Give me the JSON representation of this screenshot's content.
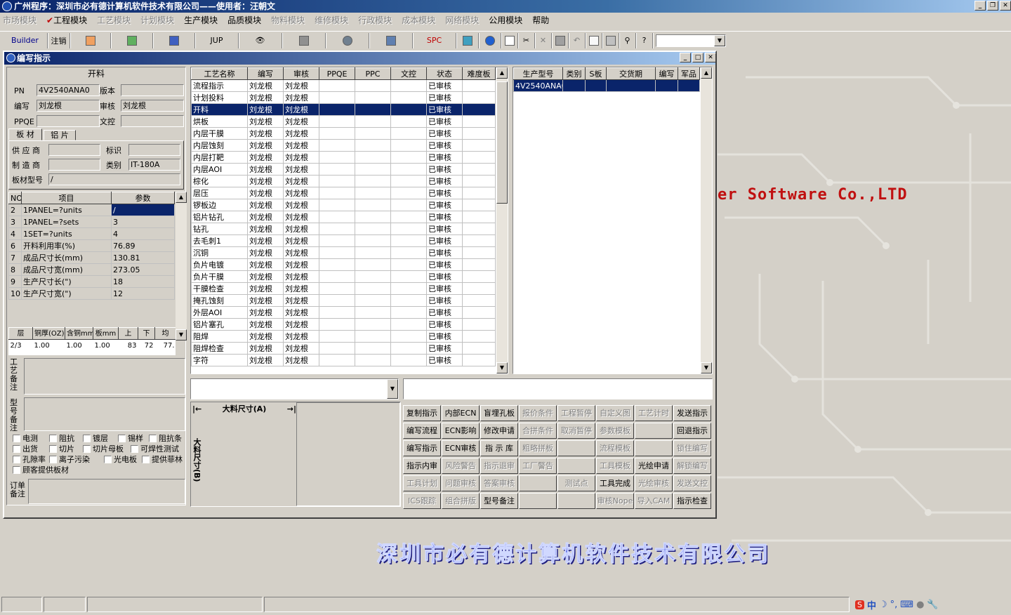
{
  "app_title": "广州程序：深圳市必有德计算机软件技术有限公司——使用者：汪朝文",
  "menu": [
    {
      "label": "市场模块",
      "enabled": false
    },
    {
      "label": "工程模块",
      "enabled": true,
      "checked": true
    },
    {
      "label": "工艺模块",
      "enabled": false
    },
    {
      "label": "计划模块",
      "enabled": false
    },
    {
      "label": "生产模块",
      "enabled": true
    },
    {
      "label": "品质模块",
      "enabled": true
    },
    {
      "label": "物料模块",
      "enabled": false
    },
    {
      "label": "维修模块",
      "enabled": false
    },
    {
      "label": "行政模块",
      "enabled": false
    },
    {
      "label": "成本模块",
      "enabled": false
    },
    {
      "label": "网络模块",
      "enabled": false
    },
    {
      "label": "公用模块",
      "enabled": true
    },
    {
      "label": "帮助",
      "enabled": true
    }
  ],
  "toolbar": {
    "builder": "Builder",
    "logout": "注销",
    "jup": "JUP",
    "spc": "SPC"
  },
  "child_title": "编写指示",
  "left": {
    "process_name": "开料",
    "pn_label": "PN",
    "pn": "4V2540ANA0",
    "version_label": "版本",
    "version": "",
    "writer_label": "编写",
    "writer": "刘龙根",
    "reviewer_label": "审核",
    "reviewer": "刘龙根",
    "ppqe_label": "PPQE",
    "ppqe": "",
    "doc_label": "文控",
    "doc": "",
    "tab_board": "板 材",
    "tab_alu": "铝 片",
    "supplier_label": "供 应 商",
    "supplier": "",
    "mark_label": "标识",
    "mark": "",
    "maker_label": "制 造 商",
    "maker": "",
    "class_label": "类别",
    "class": "IT-180A",
    "model_label": "板材型号",
    "model": "/",
    "param_headers": [
      "NO",
      "项目",
      "参数"
    ],
    "params": [
      [
        "2",
        "1PANEL=?units",
        "/"
      ],
      [
        "3",
        "1PANEL=?sets",
        "3"
      ],
      [
        "4",
        "1SET=?units",
        "4"
      ],
      [
        "6",
        "开料利用率(%)",
        "76.89"
      ],
      [
        "7",
        "成品尺寸长(mm)",
        "130.81"
      ],
      [
        "8",
        "成品尺寸宽(mm)",
        "273.05"
      ],
      [
        "9",
        "生产尺寸长(\")",
        "18"
      ],
      [
        "10",
        "生产尺寸宽(\")",
        "12"
      ]
    ],
    "layer_headers": [
      "层",
      "铜厚(OZ)",
      "含铜mm",
      "板mm",
      "上",
      "下",
      "均"
    ],
    "layer_row": [
      "2/3",
      "1.00",
      "1.00",
      "1.00",
      "83",
      "72",
      "77."
    ],
    "craft_note_label": "工艺备注",
    "model_note_label": "型号备注",
    "order_note_label": "订单备注",
    "checks": [
      [
        "电测",
        "阻抗",
        "镀层",
        "锡样",
        "阻抗条"
      ],
      [
        "出货",
        "切片",
        "切片母板",
        "可焊性测试"
      ],
      [
        "孔隙率",
        "离子污染",
        "光电板",
        "提供菲林"
      ],
      [
        "顾客提供板材"
      ]
    ]
  },
  "process_table": {
    "headers": [
      "工艺名称",
      "编写",
      "审核",
      "PPQE",
      "PPC",
      "文控",
      "状态",
      "难度板"
    ],
    "rows": [
      [
        "流程指示",
        "刘龙根",
        "刘龙根",
        "",
        "",
        "",
        "已审核",
        ""
      ],
      [
        "计划投料",
        "刘龙根",
        "刘龙根",
        "",
        "",
        "",
        "已审核",
        ""
      ],
      [
        "开料",
        "刘龙根",
        "刘龙根",
        "",
        "",
        "",
        "已审核",
        ""
      ],
      [
        "烘板",
        "刘龙根",
        "刘龙根",
        "",
        "",
        "",
        "已审核",
        ""
      ],
      [
        "内层干膜",
        "刘龙根",
        "刘龙根",
        "",
        "",
        "",
        "已审核",
        ""
      ],
      [
        "内层蚀刻",
        "刘龙根",
        "刘龙根",
        "",
        "",
        "",
        "已审核",
        ""
      ],
      [
        "内层打靶",
        "刘龙根",
        "刘龙根",
        "",
        "",
        "",
        "已审核",
        ""
      ],
      [
        "内层AOI",
        "刘龙根",
        "刘龙根",
        "",
        "",
        "",
        "已审核",
        ""
      ],
      [
        "棕化",
        "刘龙根",
        "刘龙根",
        "",
        "",
        "",
        "已审核",
        ""
      ],
      [
        "层压",
        "刘龙根",
        "刘龙根",
        "",
        "",
        "",
        "已审核",
        ""
      ],
      [
        "锣板边",
        "刘龙根",
        "刘龙根",
        "",
        "",
        "",
        "已审核",
        ""
      ],
      [
        "铝片钻孔",
        "刘龙根",
        "刘龙根",
        "",
        "",
        "",
        "已审核",
        ""
      ],
      [
        "钻孔",
        "刘龙根",
        "刘龙根",
        "",
        "",
        "",
        "已审核",
        ""
      ],
      [
        "去毛刺1",
        "刘龙根",
        "刘龙根",
        "",
        "",
        "",
        "已审核",
        ""
      ],
      [
        "沉铜",
        "刘龙根",
        "刘龙根",
        "",
        "",
        "",
        "已审核",
        ""
      ],
      [
        "负片电镀",
        "刘龙根",
        "刘龙根",
        "",
        "",
        "",
        "已审核",
        ""
      ],
      [
        "负片干膜",
        "刘龙根",
        "刘龙根",
        "",
        "",
        "",
        "已审核",
        ""
      ],
      [
        "干膜检查",
        "刘龙根",
        "刘龙根",
        "",
        "",
        "",
        "已审核",
        ""
      ],
      [
        "掩孔蚀刻",
        "刘龙根",
        "刘龙根",
        "",
        "",
        "",
        "已审核",
        ""
      ],
      [
        "外层AOI",
        "刘龙根",
        "刘龙根",
        "",
        "",
        "",
        "已审核",
        ""
      ],
      [
        "铝片塞孔",
        "刘龙根",
        "刘龙根",
        "",
        "",
        "",
        "已审核",
        ""
      ],
      [
        "阻焊",
        "刘龙根",
        "刘龙根",
        "",
        "",
        "",
        "已审核",
        ""
      ],
      [
        "阻焊检查",
        "刘龙根",
        "刘龙根",
        "",
        "",
        "",
        "已审核",
        ""
      ],
      [
        "字符",
        "刘龙根",
        "刘龙根",
        "",
        "",
        "",
        "已审核",
        ""
      ]
    ],
    "selected": 2
  },
  "model_table": {
    "headers": [
      "生产型号",
      "类别",
      "S板",
      "交货期",
      "编写",
      "军品"
    ],
    "rows": [
      [
        "4V2540ANA0",
        "",
        "",
        "",
        "",
        ""
      ]
    ]
  },
  "size_a_label": "大料尺寸(A)",
  "size_b_label": "大料尺寸(B)",
  "actions": [
    [
      [
        "复制指示",
        true
      ],
      [
        "内部ECN",
        true
      ],
      [
        "盲埋孔板",
        true
      ],
      [
        "报价条件",
        false
      ],
      [
        "工程暂停",
        false
      ],
      [
        "自定义图",
        false
      ],
      [
        "工艺计时",
        false
      ],
      [
        "发送指示",
        true
      ]
    ],
    [
      [
        "编写流程",
        true
      ],
      [
        "ECN影响",
        true
      ],
      [
        "修改申请",
        true
      ],
      [
        "合拼条件",
        false
      ],
      [
        "取消暂停",
        false
      ],
      [
        "参数模板",
        false
      ],
      [
        "",
        false
      ],
      [
        "回退指示",
        true
      ]
    ],
    [
      [
        "编写指示",
        true
      ],
      [
        "ECN审核",
        true
      ],
      [
        "指 示 库",
        true
      ],
      [
        "粗略拼板",
        false
      ],
      [
        "",
        false
      ],
      [
        "流程模板",
        false
      ],
      [
        "",
        false
      ],
      [
        "锁住编写",
        false
      ]
    ],
    [
      [
        "指示内审",
        true
      ],
      [
        "风险警告",
        false
      ],
      [
        "指示退审",
        false
      ],
      [
        "工厂警告",
        false
      ],
      [
        "",
        false
      ],
      [
        "工具模板",
        false
      ],
      [
        "光绘申请",
        true
      ],
      [
        "解锁编写",
        false
      ]
    ],
    [
      [
        "工具计划",
        false
      ],
      [
        "问题审核",
        false
      ],
      [
        "答案审核",
        false
      ],
      [
        "",
        false
      ],
      [
        "测试点",
        false
      ],
      [
        "工具完成",
        true
      ],
      [
        "光绘审核",
        false
      ],
      [
        "发送文控",
        false
      ]
    ],
    [
      [
        "ICS跟踪",
        false
      ],
      [
        "组合拼版",
        false
      ],
      [
        "型号备注",
        true
      ],
      [
        "",
        false
      ],
      [
        "",
        false
      ],
      [
        "审核Nope",
        false
      ],
      [
        "导入CAM",
        false
      ],
      [
        "指示检查",
        true
      ]
    ]
  ],
  "brand_en": "er Software Co.,LTD",
  "brand_cn": "深圳市必有德计算机软件技术有限公司",
  "tray": {
    "ime": "中"
  }
}
